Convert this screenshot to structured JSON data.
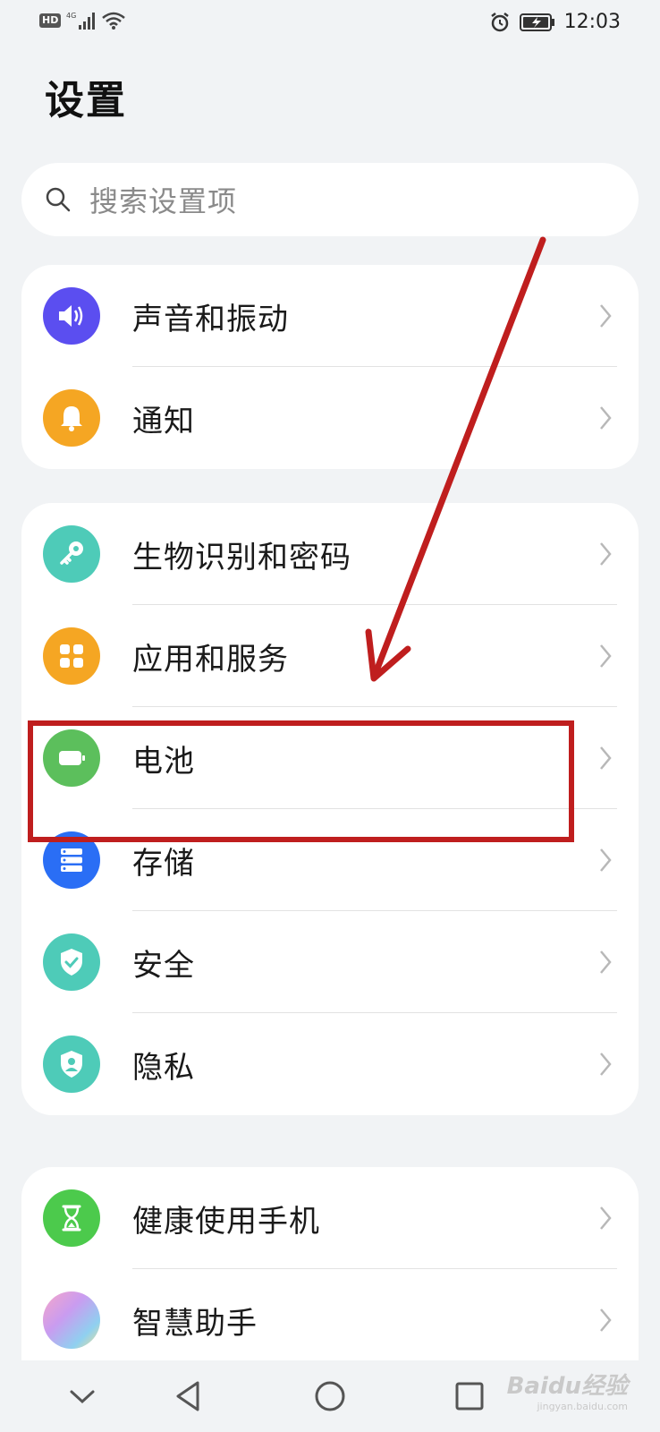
{
  "status_bar": {
    "hd": "HD",
    "network": "4G",
    "time": "12:03",
    "icons": [
      "signal-icon",
      "wifi-icon",
      "alarm-icon",
      "battery-charging-icon"
    ]
  },
  "title": "设置",
  "search": {
    "placeholder": "搜索设置项"
  },
  "groups": [
    {
      "items": [
        {
          "label": "声音和振动",
          "icon": "speaker-icon",
          "color": "#5b4ef0"
        },
        {
          "label": "通知",
          "icon": "bell-icon",
          "color": "#f5a623"
        }
      ]
    },
    {
      "items": [
        {
          "label": "生物识别和密码",
          "icon": "key-icon",
          "color": "#4ecbb8"
        },
        {
          "label": "应用和服务",
          "icon": "apps-grid-icon",
          "color": "#f5a623"
        },
        {
          "label": "电池",
          "icon": "battery-icon",
          "color": "#5cbf5c"
        },
        {
          "label": "存储",
          "icon": "storage-icon",
          "color": "#2a6ef5"
        },
        {
          "label": "安全",
          "icon": "shield-check-icon",
          "color": "#4ecbb8"
        },
        {
          "label": "隐私",
          "icon": "privacy-shield-icon",
          "color": "#4ecbb8"
        }
      ]
    },
    {
      "items": [
        {
          "label": "健康使用手机",
          "icon": "hourglass-icon",
          "color": "#4cca4c"
        },
        {
          "label": "智慧助手",
          "icon": "assistant-icon",
          "color": "#e98fd0"
        }
      ]
    }
  ],
  "annotation": {
    "highlight_color": "#bf1e1e"
  },
  "nav_bar": {
    "buttons": [
      "collapse-icon",
      "back-icon",
      "home-icon",
      "recents-icon"
    ]
  },
  "watermark": {
    "main": "Baidu经验",
    "sub": "jingyan.baidu.com"
  }
}
